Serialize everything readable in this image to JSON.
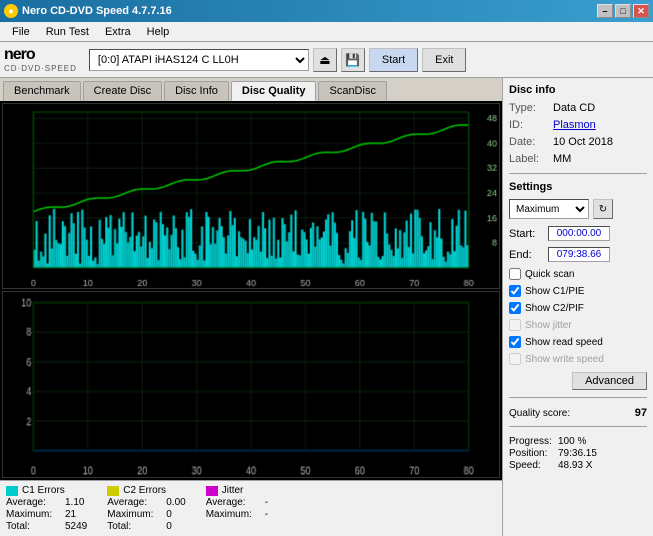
{
  "titleBar": {
    "title": "Nero CD-DVD Speed 4.7.7.16",
    "minBtn": "–",
    "maxBtn": "□",
    "closeBtn": "✕"
  },
  "menu": {
    "items": [
      "File",
      "Run Test",
      "Extra",
      "Help"
    ]
  },
  "toolbar": {
    "logoTop": "nero",
    "logoBottom": "CD·DVD·SPEED",
    "driveValue": "[0:0]  ATAPI iHAS124  C LL0H",
    "startLabel": "Start",
    "exitLabel": "Exit"
  },
  "tabs": {
    "items": [
      "Benchmark",
      "Create Disc",
      "Disc Info",
      "Disc Quality",
      "ScanDisc"
    ],
    "active": 3
  },
  "discInfo": {
    "sectionTitle": "Disc info",
    "typeLabel": "Type:",
    "typeValue": "Data CD",
    "idLabel": "ID:",
    "idValue": "Plasmon",
    "dateLabel": "Date:",
    "dateValue": "10 Oct 2018",
    "labelLabel": "Label:",
    "labelValue": "MM"
  },
  "settings": {
    "sectionTitle": "Settings",
    "speedValue": "Maximum",
    "startLabel": "Start:",
    "startValue": "000:00.00",
    "endLabel": "End:",
    "endValue": "079:38.66"
  },
  "checkboxes": {
    "quickScan": {
      "label": "Quick scan",
      "checked": false,
      "disabled": false
    },
    "showC1PIE": {
      "label": "Show C1/PIE",
      "checked": true,
      "disabled": false
    },
    "showC2PIF": {
      "label": "Show C2/PIF",
      "checked": true,
      "disabled": false
    },
    "showJitter": {
      "label": "Show jitter",
      "checked": false,
      "disabled": true
    },
    "showReadSpeed": {
      "label": "Show read speed",
      "checked": true,
      "disabled": false
    },
    "showWriteSpeed": {
      "label": "Show write speed",
      "checked": false,
      "disabled": true
    }
  },
  "advancedBtn": "Advanced",
  "qualityScore": {
    "label": "Quality score:",
    "value": "97"
  },
  "progress": {
    "progressLabel": "Progress:",
    "progressValue": "100 %",
    "positionLabel": "Position:",
    "positionValue": "79:36.15",
    "speedLabel": "Speed:",
    "speedValue": "48.93 X"
  },
  "stats": {
    "c1": {
      "label": "C1 Errors",
      "color": "#00cccc",
      "avgLabel": "Average:",
      "avgValue": "1.10",
      "maxLabel": "Maximum:",
      "maxValue": "21",
      "totalLabel": "Total:",
      "totalValue": "5249"
    },
    "c2": {
      "label": "C2 Errors",
      "color": "#cccc00",
      "avgLabel": "Average:",
      "avgValue": "0.00",
      "maxLabel": "Maximum:",
      "maxValue": "0",
      "totalLabel": "Total:",
      "totalValue": "0"
    },
    "jitter": {
      "label": "Jitter",
      "color": "#cc00cc",
      "avgLabel": "Average:",
      "avgValue": "-",
      "maxLabel": "Maximum:",
      "maxValue": "-"
    }
  },
  "chartUpper": {
    "yMax": 50,
    "yLabels": [
      48,
      40,
      32,
      24,
      16,
      8
    ],
    "xLabels": [
      0,
      10,
      20,
      30,
      40,
      50,
      60,
      70,
      80
    ]
  },
  "chartLower": {
    "yMax": 10,
    "yLabels": [
      10,
      8,
      6,
      4,
      2
    ],
    "xLabels": [
      0,
      10,
      20,
      30,
      40,
      50,
      60,
      70,
      80
    ]
  }
}
